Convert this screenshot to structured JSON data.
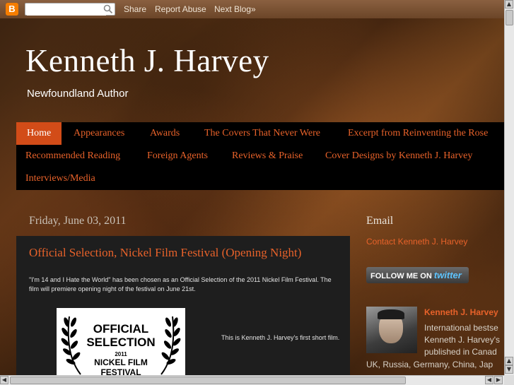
{
  "navbar": {
    "search_placeholder": "",
    "share": "Share",
    "report_abuse": "Report Abuse",
    "next_blog": "Next Blog»"
  },
  "header": {
    "title": "Kenneth J. Harvey",
    "description": "Newfoundland Author"
  },
  "tabs": [
    "Home",
    "Appearances",
    "Awards",
    "The Covers That Never Were",
    "Excerpt from Reinventing the Rose",
    "Recommended Reading",
    "Foreign Agents",
    "Reviews & Praise",
    "Cover Designs by Kenneth J. Harvey",
    "Interviews/Media"
  ],
  "post": {
    "date": "Friday, June 03, 2011",
    "title": "Official Selection, Nickel Film Festival (Opening Night)",
    "body": "\"I'm 14 and I Hate the World\" has been chosen as an Official Selection of the 2011 Nickel Film Festival. The film will premiere opening night of the festival on June 21st.",
    "image_lines": [
      "OFFICIAL",
      "SELECTION",
      "2011",
      "NICKEL FILM",
      "FESTIVAL"
    ],
    "caption": "This is Kenneth J. Harvey's first short film."
  },
  "sidebar": {
    "email_heading": "Email",
    "contact_link": "Contact Kenneth J. Harvey",
    "twitter_prefix": "FOLLOW ME ON",
    "twitter_brand": "twitter",
    "profile_name": "Kenneth J. Harvey",
    "profile_lines": [
      "International bestse",
      "Kenneth J. Harvey's",
      "published in Canad"
    ],
    "profile_line_last": "UK, Russia, Germany, China, Jap"
  },
  "colors": {
    "accent": "#e8622a",
    "active_tab": "#d24c18"
  }
}
